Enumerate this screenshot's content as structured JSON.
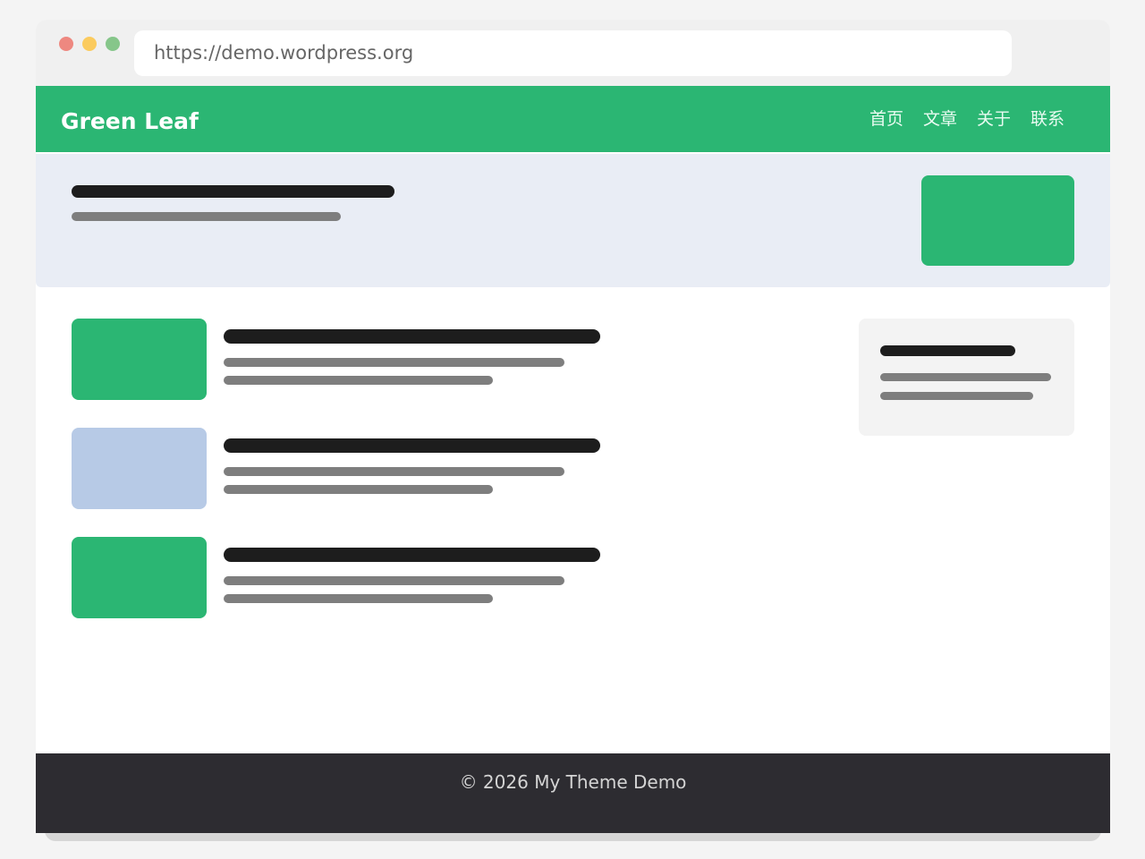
{
  "browser": {
    "url": "https://demo.wordpress.org"
  },
  "site": {
    "title": "Green Leaf",
    "nav": [
      "首页",
      "文章",
      "关于",
      "联系"
    ]
  },
  "colors": {
    "accent": "#2bb673",
    "thumb_alt": "#b7cae6",
    "footer_bg": "#2d2c31"
  },
  "posts": [
    {
      "thumb_color": "#2bb673"
    },
    {
      "thumb_color": "#b7cae6"
    },
    {
      "thumb_color": "#2bb673"
    }
  ],
  "footer": {
    "text": "© 2026 My Theme Demo"
  }
}
